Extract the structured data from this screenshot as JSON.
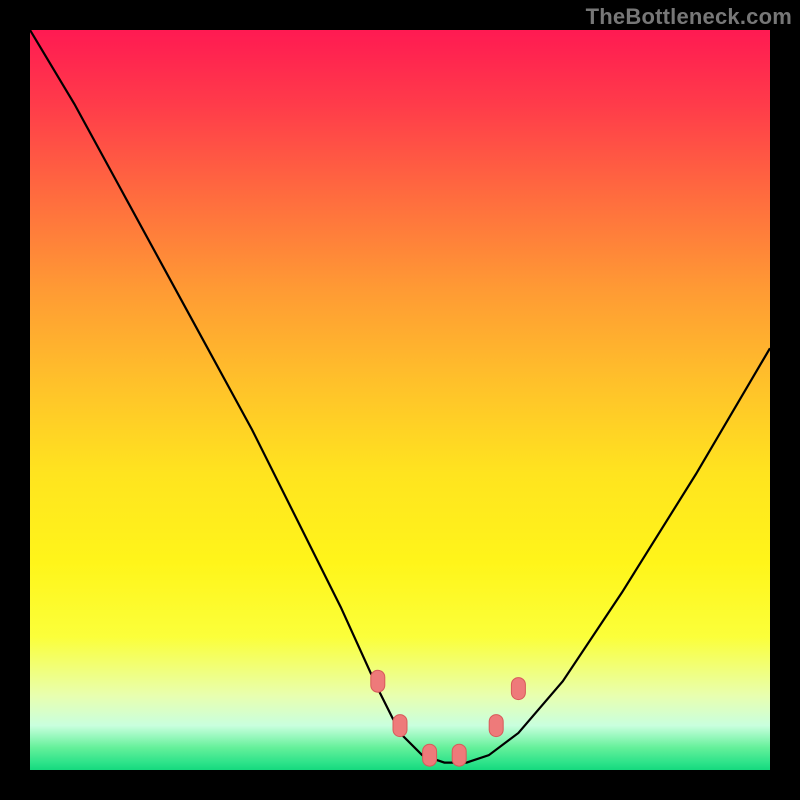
{
  "watermark": "TheBottleneck.com",
  "chart_data": {
    "type": "line",
    "title": "",
    "xlabel": "",
    "ylabel": "",
    "xlim": [
      0,
      100
    ],
    "ylim": [
      0,
      100
    ],
    "series": [
      {
        "name": "bottleneck-curve",
        "x": [
          0,
          6,
          12,
          18,
          24,
          30,
          36,
          42,
          47,
          50,
          53,
          56,
          59,
          62,
          66,
          72,
          80,
          90,
          100
        ],
        "y": [
          100,
          90,
          79,
          68,
          57,
          46,
          34,
          22,
          11,
          5,
          2,
          1,
          1,
          2,
          5,
          12,
          24,
          40,
          57
        ]
      }
    ],
    "markers": [
      {
        "name": "marker-left-1",
        "x": 47,
        "y": 12
      },
      {
        "name": "marker-left-2",
        "x": 50,
        "y": 6
      },
      {
        "name": "marker-floor-1",
        "x": 54,
        "y": 2
      },
      {
        "name": "marker-floor-2",
        "x": 58,
        "y": 2
      },
      {
        "name": "marker-right-1",
        "x": 63,
        "y": 6
      },
      {
        "name": "marker-right-2",
        "x": 66,
        "y": 11
      }
    ],
    "colors": {
      "curve": "#000000",
      "marker_fill": "#ee7a7a",
      "marker_stroke": "#d85a5a"
    }
  }
}
